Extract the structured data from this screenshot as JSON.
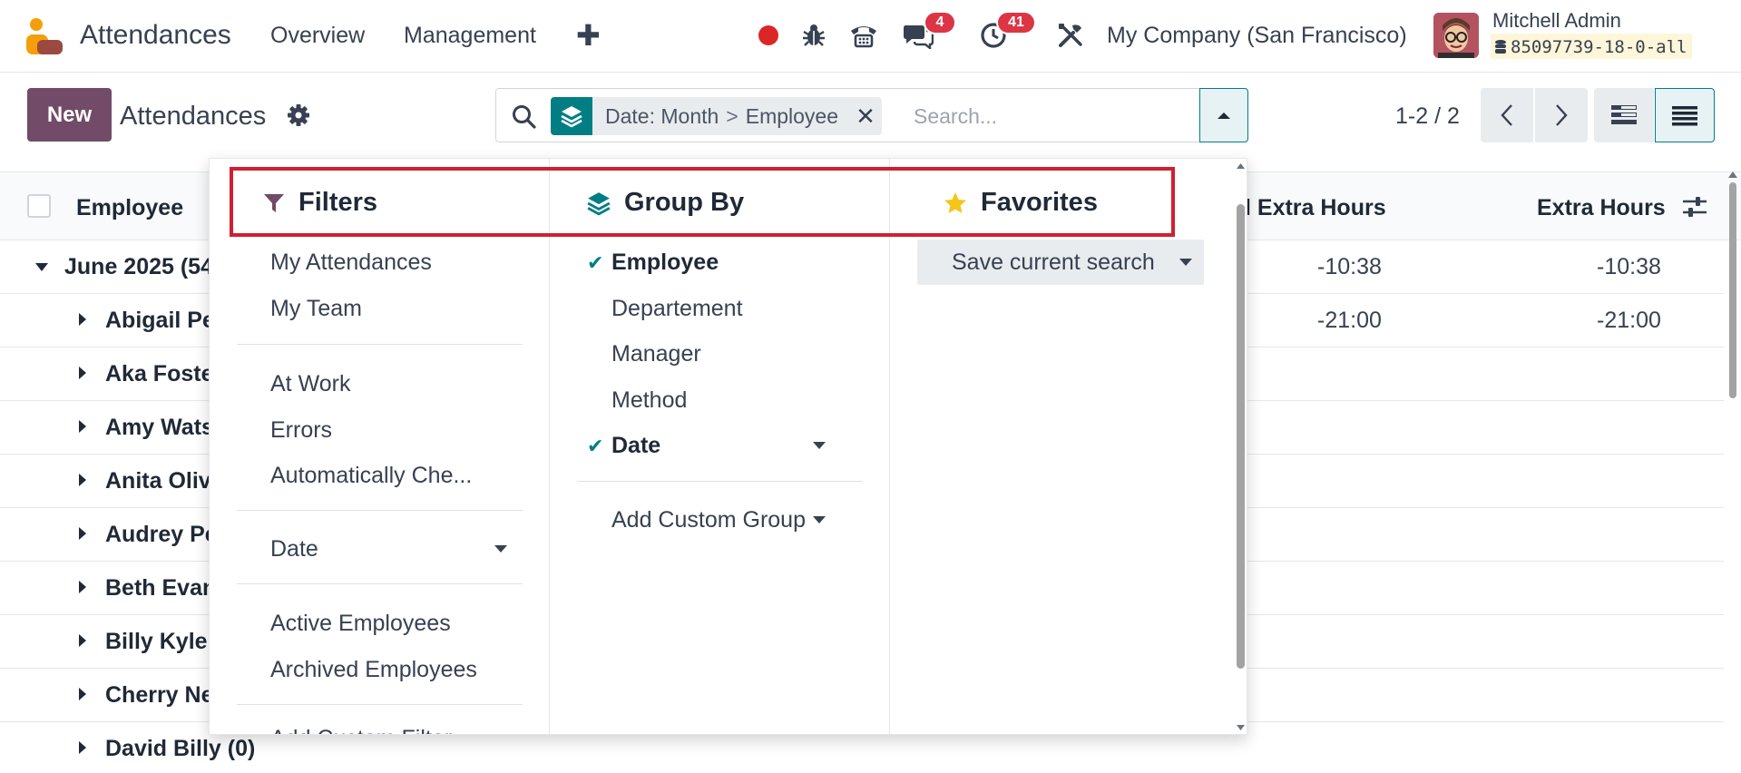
{
  "navbar": {
    "app_title": "Attendances",
    "menu": [
      "Overview",
      "Management"
    ],
    "plus": "✚",
    "chat_badge": "4",
    "activity_badge": "41",
    "company": "My Company (San Francisco)",
    "user_name": "Mitchell Admin",
    "db_name": "85097739-18-0-all"
  },
  "control_panel": {
    "new_button": "New",
    "title": "Attendances",
    "facet_field": "Date: Month",
    "facet_sep": ">",
    "facet_value": "Employee",
    "facet_close": "✕",
    "search_placeholder": "Search...",
    "pager": "1-2 / 2"
  },
  "list": {
    "columns": [
      "Employee",
      "l Extra Hours",
      "Extra Hours"
    ],
    "group_row": {
      "label": "June 2025 (54",
      "col1": "-10:38",
      "col2": "-10:38"
    },
    "rows": [
      {
        "label": "Abigail Pe",
        "col1": "-21:00",
        "col2": "-21:00"
      },
      {
        "label": "Aka Foste",
        "col1": "",
        "col2": ""
      },
      {
        "label": "Amy Wats",
        "col1": "",
        "col2": ""
      },
      {
        "label": "Anita Oliv",
        "col1": "",
        "col2": ""
      },
      {
        "label": "Audrey Pe",
        "col1": "",
        "col2": ""
      },
      {
        "label": "Beth Evan",
        "col1": "",
        "col2": ""
      },
      {
        "label": "Billy Kyle",
        "col1": "",
        "col2": ""
      },
      {
        "label": "Cherry Ne",
        "col1": "",
        "col2": ""
      },
      {
        "label": "David Billy (0)",
        "col1": "",
        "col2": ""
      }
    ]
  },
  "dropdown": {
    "filters": {
      "title": "Filters",
      "items": [
        "My Attendances",
        "My Team",
        "At Work",
        "Errors",
        "Automatically Che...",
        "Date",
        "Active Employees",
        "Archived Employees",
        "Add Custom Filter"
      ]
    },
    "group_by": {
      "title": "Group By",
      "items": [
        "Employee",
        "Departement",
        "Manager",
        "Method",
        "Date",
        "Add Custom Group"
      ]
    },
    "favorites": {
      "title": "Favorites",
      "save_search": "Save current search"
    }
  },
  "colors": {
    "primary": "#714b67",
    "teal": "#017e84",
    "badge_red": "#dc3545",
    "highlight_red": "#d0202f"
  },
  "icons": [
    "attendances-logo-icon",
    "record-icon",
    "bug-icon",
    "phone-icon",
    "chat-icon",
    "clock-icon",
    "tools-icon",
    "gear-icon",
    "search-icon",
    "layers-icon",
    "filter-icon",
    "star-icon"
  ]
}
